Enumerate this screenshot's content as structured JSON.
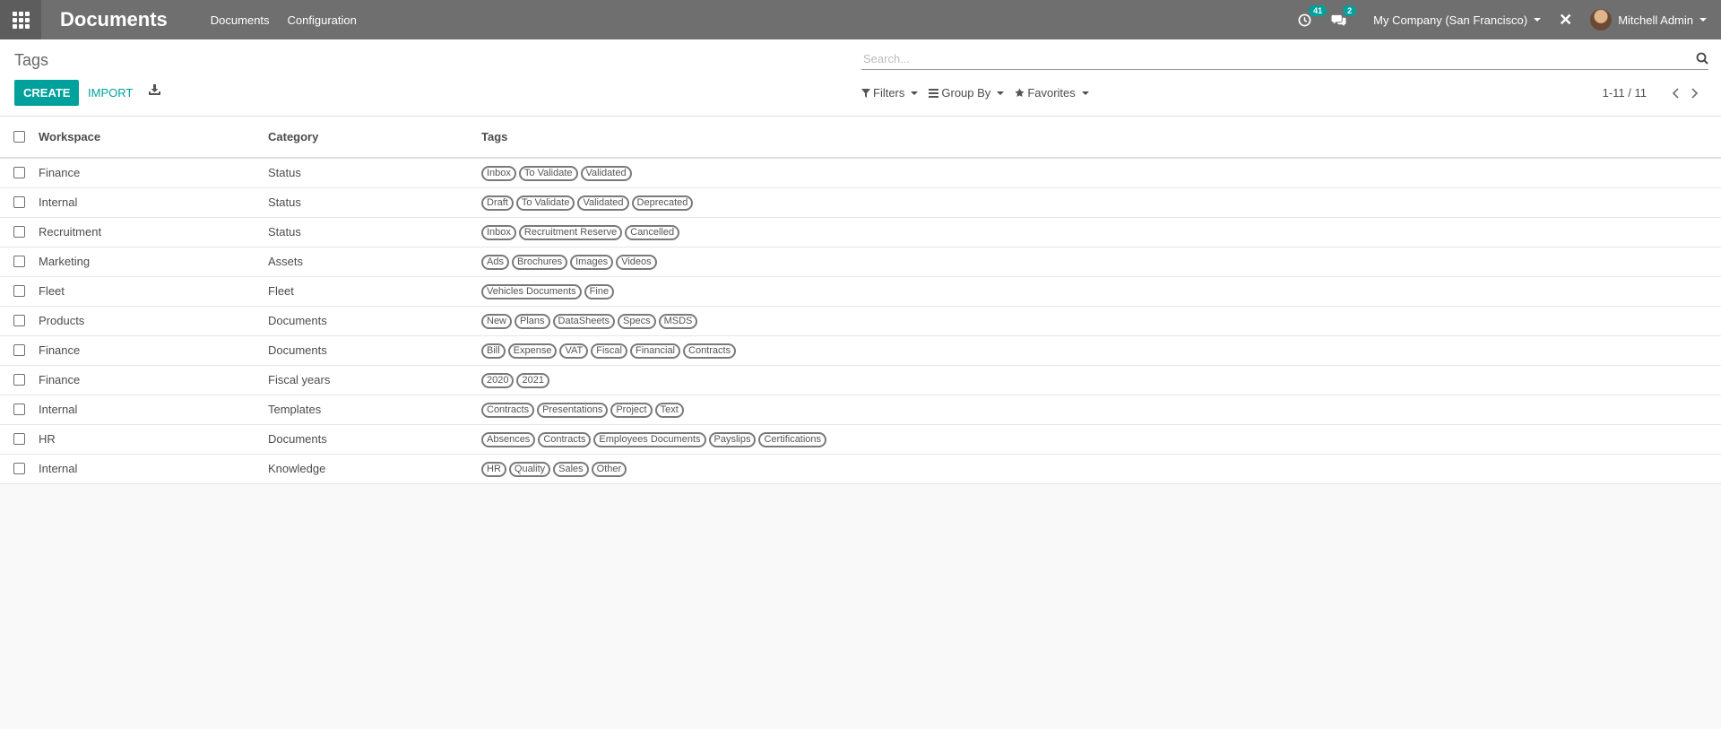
{
  "navbar": {
    "app_name": "Documents",
    "menu": [
      "Documents",
      "Configuration"
    ],
    "activity_count": "41",
    "message_count": "2",
    "company": "My Company (San Francisco)",
    "user": "Mitchell Admin"
  },
  "control_panel": {
    "breadcrumb": "Tags",
    "create_label": "CREATE",
    "import_label": "IMPORT",
    "search_placeholder": "Search...",
    "filters_label": "Filters",
    "group_by_label": "Group By",
    "favorites_label": "Favorites",
    "pager": "1-11 / 11"
  },
  "table": {
    "columns": [
      "Workspace",
      "Category",
      "Tags"
    ],
    "rows": [
      {
        "workspace": "Finance",
        "category": "Status",
        "tags": [
          "Inbox",
          "To Validate",
          "Validated"
        ]
      },
      {
        "workspace": "Internal",
        "category": "Status",
        "tags": [
          "Draft",
          "To Validate",
          "Validated",
          "Deprecated"
        ]
      },
      {
        "workspace": "Recruitment",
        "category": "Status",
        "tags": [
          "Inbox",
          "Recruitment Reserve",
          "Cancelled"
        ]
      },
      {
        "workspace": "Marketing",
        "category": "Assets",
        "tags": [
          "Ads",
          "Brochures",
          "Images",
          "Videos"
        ]
      },
      {
        "workspace": "Fleet",
        "category": "Fleet",
        "tags": [
          "Vehicles Documents",
          "Fine"
        ]
      },
      {
        "workspace": "Products",
        "category": "Documents",
        "tags": [
          "New",
          "Plans",
          "DataSheets",
          "Specs",
          "MSDS"
        ]
      },
      {
        "workspace": "Finance",
        "category": "Documents",
        "tags": [
          "Bill",
          "Expense",
          "VAT",
          "Fiscal",
          "Financial",
          "Contracts"
        ]
      },
      {
        "workspace": "Finance",
        "category": "Fiscal years",
        "tags": [
          "2020",
          "2021"
        ]
      },
      {
        "workspace": "Internal",
        "category": "Templates",
        "tags": [
          "Contracts",
          "Presentations",
          "Project",
          "Text"
        ]
      },
      {
        "workspace": "HR",
        "category": "Documents",
        "tags": [
          "Absences",
          "Contracts",
          "Employees Documents",
          "Payslips",
          "Certifications"
        ]
      },
      {
        "workspace": "Internal",
        "category": "Knowledge",
        "tags": [
          "HR",
          "Quality",
          "Sales",
          "Other"
        ]
      }
    ]
  },
  "colors": {
    "navbar": "#6f6f6f",
    "accent": "#00a09d"
  }
}
